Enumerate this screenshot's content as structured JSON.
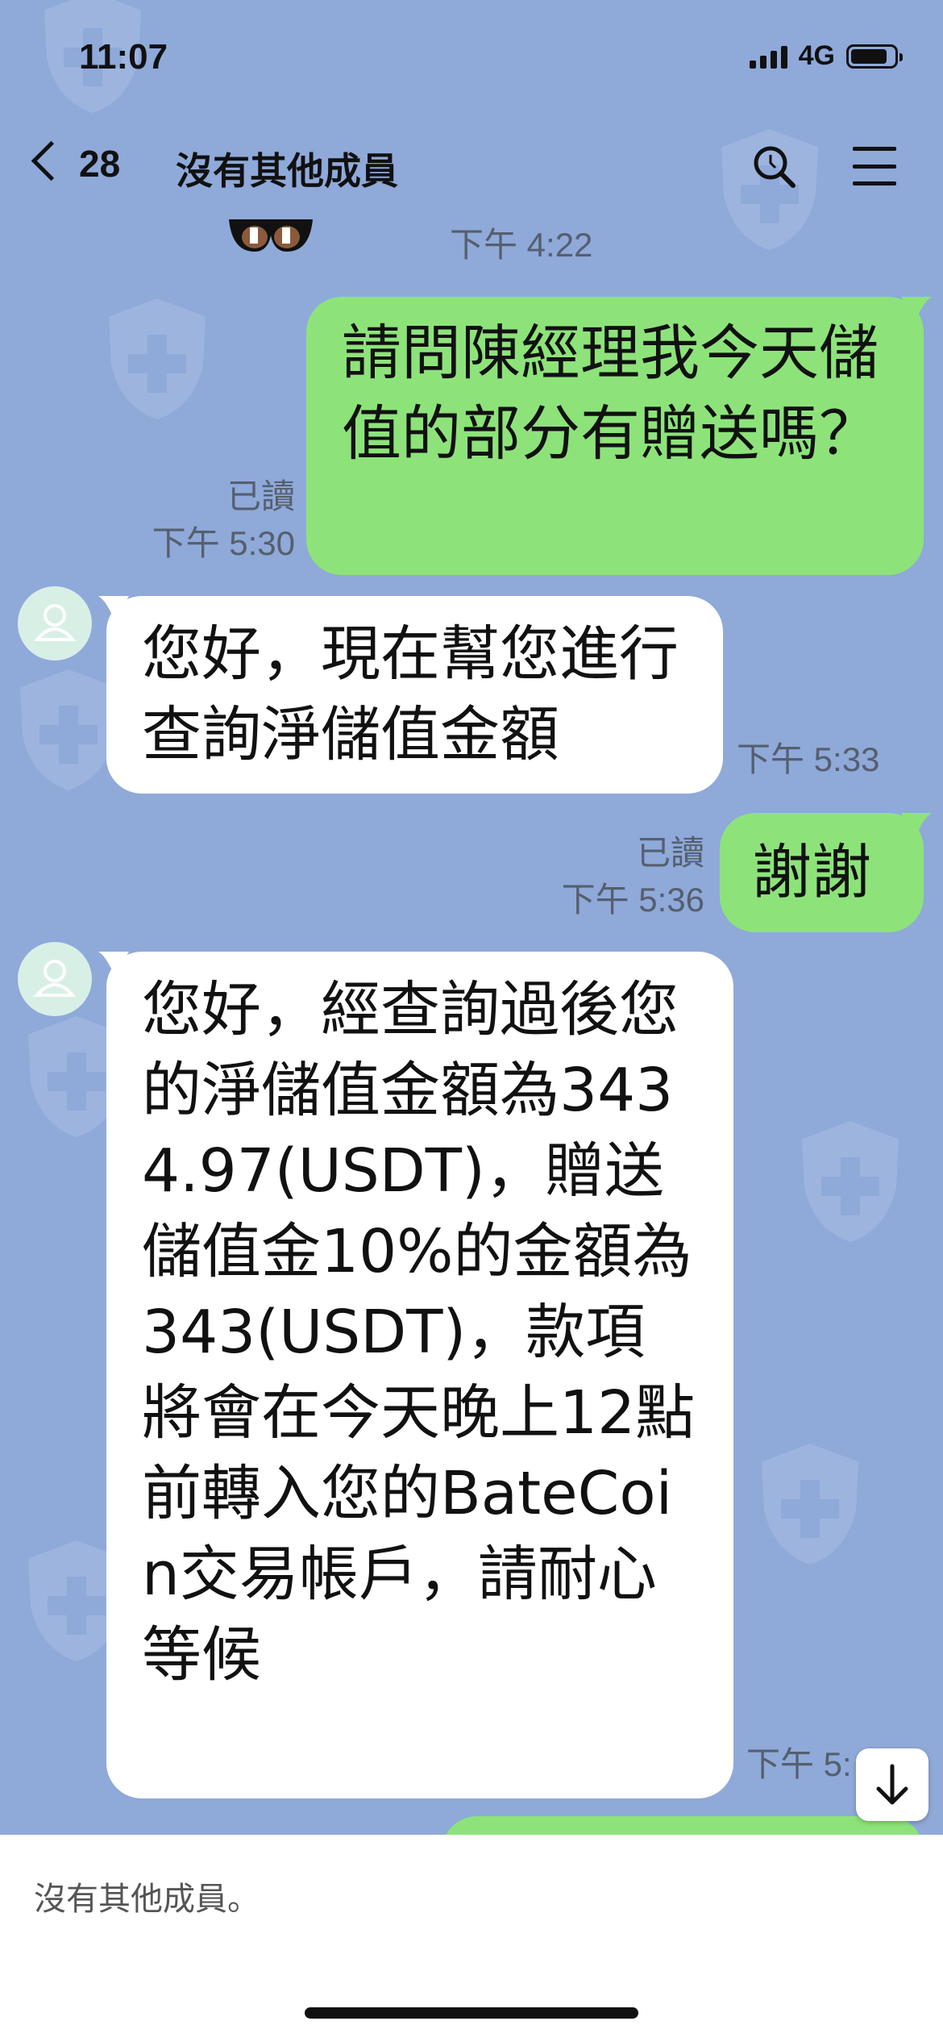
{
  "status_bar": {
    "time": "11:07",
    "network": "4G",
    "signal_bars": 4,
    "battery_level": 0.85
  },
  "header": {
    "back_count": "28",
    "title": "沒有其他成員"
  },
  "messages": [
    {
      "side": "meta",
      "time": "下午 4:22"
    },
    {
      "side": "mine",
      "text": "請問陳經理我今天儲值的部分有贈送嗎？",
      "read": "已讀",
      "time": "下午 5:30"
    },
    {
      "side": "theirs",
      "text": "您好，現在幫您進行查詢淨儲值金額",
      "time": "下午 5:33"
    },
    {
      "side": "mine",
      "text": "謝謝",
      "read": "已讀",
      "time": "下午 5:36"
    },
    {
      "side": "theirs",
      "text": "您好，經查詢過後您的淨儲值金額為3434.97(USDT)，贈送儲值金10%的金額為343(USDT)，款項將會在今天晚上12點前轉入您的BateCoin交易帳戶，請耐心等候",
      "time": "下午 5:"
    }
  ],
  "footer": {
    "notice": "沒有其他成員。"
  },
  "colors": {
    "background": "#8fa9d9",
    "my_bubble": "#8de37a",
    "their_bubble": "#ffffff"
  },
  "icons": {
    "back": "chevron-left-icon",
    "search": "search-icon",
    "menu": "menu-icon",
    "scroll": "arrow-down-icon"
  }
}
